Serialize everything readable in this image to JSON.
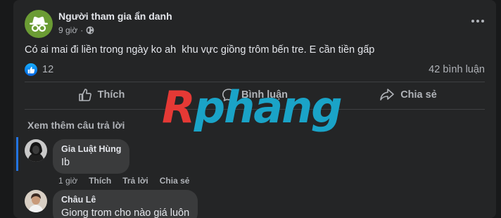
{
  "post": {
    "author": "Người tham gia ẩn danh",
    "time": "9 giờ",
    "dot": "·",
    "text": "Có ai mai đi liền trong ngày ko ah  khu vực giồng trôm bến tre. E cần tiền gấp",
    "like_count": "12",
    "comment_count": "42 bình luận"
  },
  "actions": {
    "like": "Thích",
    "comment": "Bình luận",
    "share": "Chia sẻ"
  },
  "watermark": {
    "first": "R",
    "rest": "phang"
  },
  "comments_section": {
    "see_more": "Xem thêm câu trả lời",
    "comments": [
      {
        "name": "Gia Luật Hùng",
        "text": "Ib",
        "time": "1 giờ",
        "like": "Thích",
        "reply": "Trả lời",
        "share": "Chia sẻ"
      },
      {
        "name": "Châu Lê",
        "text": "Giong trom cho nào giá luôn"
      }
    ]
  },
  "icons": {
    "avatar_main": "incognito-icon",
    "privacy": "globe-icon",
    "more": "more-options-icon",
    "like_badge": "thumbs-up-icon",
    "like_action": "thumbs-up-outline-icon",
    "comment_action": "comment-bubble-icon",
    "share_action": "share-arrow-icon"
  },
  "colors": {
    "background": "#18191a",
    "card": "#242526",
    "bubble": "#3a3b3c",
    "accent": "#2374e1",
    "avatar_green": "#6b9c34"
  }
}
